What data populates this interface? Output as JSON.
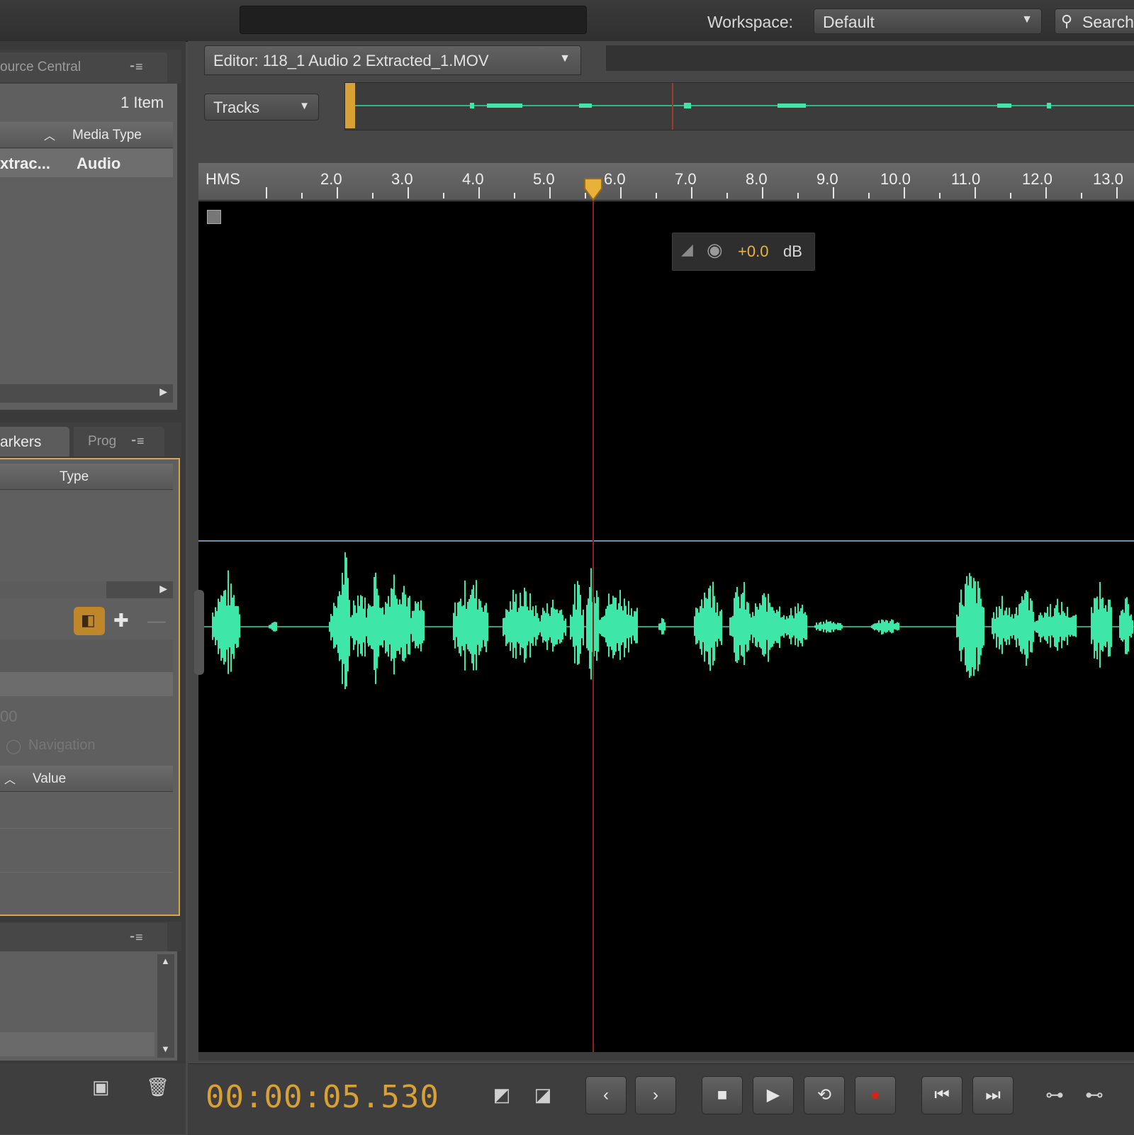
{
  "top_bar": {
    "workspace_label": "Workspace:",
    "workspace_value": "Default",
    "search_label": "Search"
  },
  "resource_central": {
    "tab_label": "ource Central",
    "item_count": "1 Item",
    "column_media_type": "Media Type",
    "row_name": "xtrac...",
    "row_type": "Audio"
  },
  "markers": {
    "tab_markers": "arkers",
    "tab_prog": "Prog",
    "column_type": "Type",
    "faded_value": "00",
    "faded_nav": "Navigation",
    "column_value": "Value"
  },
  "editor": {
    "file_tab": "Editor: 118_1 Audio 2 Extracted_1.MOV",
    "tracks_label": "Tracks",
    "ruler_unit": "HMS",
    "ruler_ticks": [
      "2.0",
      "3.0",
      "4.0",
      "5.0",
      "6.0",
      "7.0",
      "8.0",
      "9.0",
      "10.0",
      "11.0",
      "12.0",
      "13.0"
    ],
    "db_value": "+0.0",
    "db_unit": "dB",
    "timecode": "00:00:05.530",
    "playhead_seconds": 5.53
  },
  "colors": {
    "waveform": "#3ee6a8",
    "playhead": "#e8b23a",
    "timecode": "#d9a033"
  }
}
